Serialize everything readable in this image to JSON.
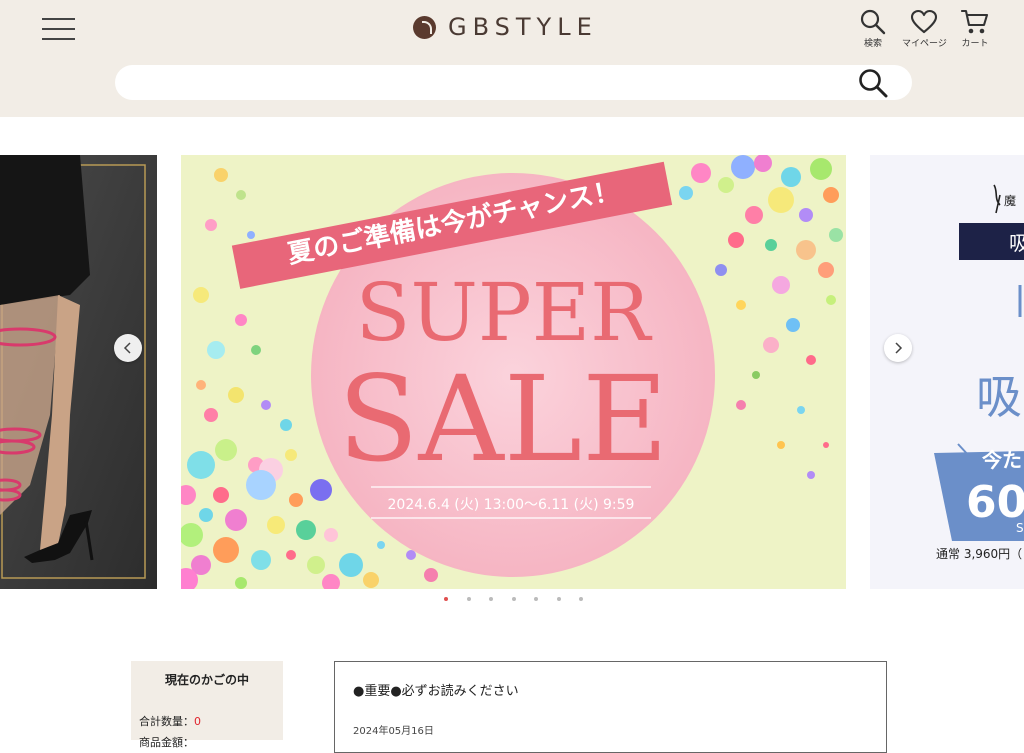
{
  "header": {
    "logo_text": "GBSTYLE",
    "icons": [
      {
        "name": "search-icon",
        "label": "検索"
      },
      {
        "name": "heart-icon",
        "label": "マイページ"
      },
      {
        "name": "cart-icon",
        "label": "カート"
      }
    ],
    "search": {
      "placeholder": "",
      "value": ""
    }
  },
  "banner": {
    "main": {
      "tagline": "夏のご準備は今がチャンス！",
      "headline_1": "SUPER",
      "headline_2": "SALE",
      "period": "2024.6.4 (火) 13:00～6.11 (火) 9:59"
    },
    "right": {
      "brand_fragment": "魔",
      "badge_text": "吸",
      "big_char": "吸",
      "promo_top": "今た",
      "promo_value": "60",
      "promo_small": "S",
      "price_text": "通常 3,960円（"
    },
    "dots_count": 7,
    "active_dot": 0
  },
  "cart": {
    "title": "現在のかごの中",
    "qty_label": "合計数量：",
    "qty_value": "0",
    "amount_label": "商品金額："
  },
  "notice": {
    "title": "●重要●必ずお読みください",
    "date": "2024年05月16日"
  },
  "colors": {
    "header_bg": "#f2ede6",
    "accent_pink": "#e8667a",
    "sale_text": "#e96a72",
    "navy": "#1d2247",
    "promo_blue": "#6b8fc9"
  }
}
